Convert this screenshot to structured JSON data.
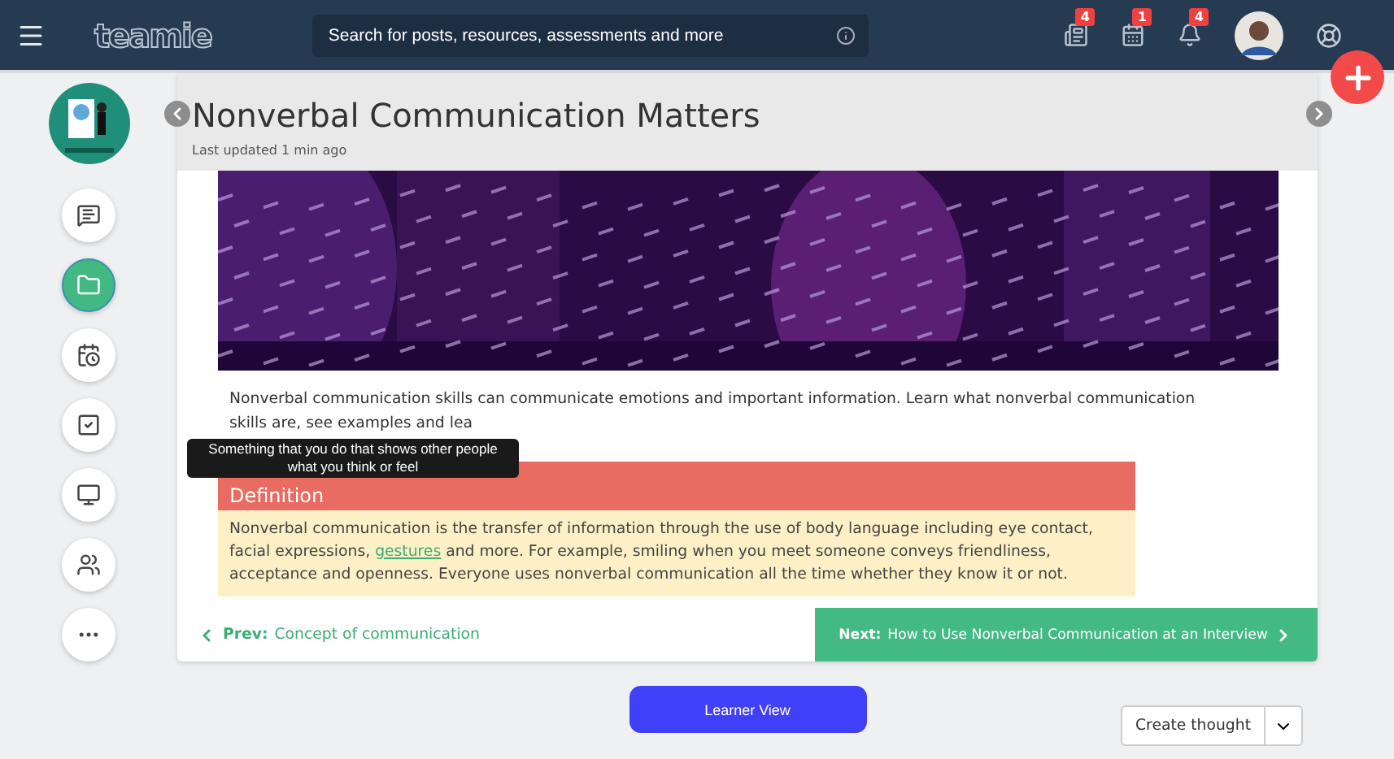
{
  "topbar": {
    "logo": "teamie",
    "search": {
      "placeholder": "Search for posts, resources, assessments and more"
    },
    "badges": [
      {
        "kind": "posts",
        "count": "4"
      },
      {
        "kind": "calendar",
        "count": "1"
      },
      {
        "kind": "bell",
        "count": "4"
      }
    ]
  },
  "sidebar": {
    "items": [
      {
        "kind": "chat",
        "selected": false
      },
      {
        "kind": "folder",
        "selected": true
      },
      {
        "kind": "schedule",
        "selected": false
      },
      {
        "kind": "check",
        "selected": false
      },
      {
        "kind": "monitor",
        "selected": false
      },
      {
        "kind": "people",
        "selected": false
      },
      {
        "kind": "more",
        "selected": false
      }
    ]
  },
  "page": {
    "title": "Nonverbal Communication Matters",
    "updated": "Last updated 1 min ago",
    "intro": "Nonverbal communication skills can communicate emotions and important information. Learn what nonverbal communication skills are, see examples and lea",
    "definition": {
      "heading": "Definition",
      "before": "Nonverbal communication is the transfer of information through the use of body language including eye contact, facial expressions, ",
      "link": "gestures",
      "after": " and more. For example, smiling when you meet someone conveys friendliness, acceptance and openness. Everyone uses nonverbal communication all the time whether they know it or not."
    },
    "tooltip": "Something that you do that shows other people what you think or feel"
  },
  "nav": {
    "prev_label": "Prev:",
    "prev": "Concept of communication",
    "next_label": "Next:",
    "next": "How to Use Nonverbal Communication at an Interview"
  },
  "buttons": {
    "learner_view": "Learner View",
    "create_thought": "Create thought"
  }
}
